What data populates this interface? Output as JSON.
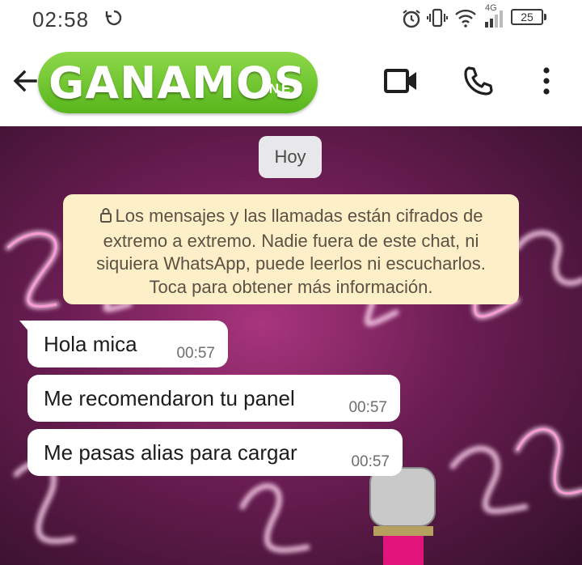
{
  "status_bar": {
    "time": "02:58",
    "network": "4G",
    "battery": "25"
  },
  "header": {
    "logo": "GANAMOS",
    "logo_suffix": ".NET",
    "icons": [
      "back-arrow-icon",
      "video-call-icon",
      "voice-call-icon",
      "more-options-icon"
    ]
  },
  "chat": {
    "date_chip": "Hoy",
    "encryption_notice": {
      "line1": "Los mensajes y las llamadas están cifrados de",
      "line2": "extremo a extremo. Nadie fuera de este chat, ni",
      "line3": "siquiera WhatsApp, puede leerlos ni escucharlos.",
      "line4": "Toca para obtener más información."
    },
    "messages": [
      {
        "text": "Hola mica",
        "time": "00:57"
      },
      {
        "text": "Me recomendaron tu panel",
        "time": "00:57"
      },
      {
        "text": "Me pasas alias para cargar",
        "time": "00:57"
      }
    ]
  },
  "colors": {
    "logo_green": "#6cc62c",
    "notice_bg": "#fdefc8",
    "bubble_bg": "#ffffff",
    "wallpaper_pink": "#a8357d"
  }
}
